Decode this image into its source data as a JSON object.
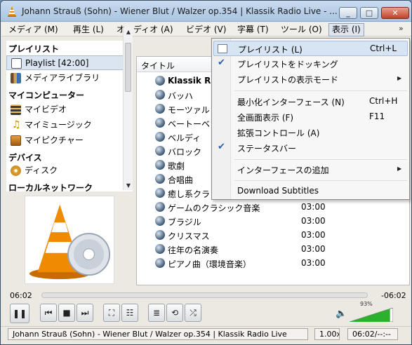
{
  "window": {
    "title": "Johann Strauß (Sohn) - Wiener Blut / Walzer op.354 | Klassik Radio Live - ..."
  },
  "menubar": {
    "items": [
      {
        "label": "メディア (M)"
      },
      {
        "label": "再生 (L)"
      },
      {
        "label": "オーディオ (A)"
      },
      {
        "label": "ビデオ (V)"
      },
      {
        "label": "字幕 (T)"
      },
      {
        "label": "ツール (O)"
      },
      {
        "label": "表示 (I)"
      }
    ],
    "overflow": "»"
  },
  "sidebar": {
    "sections": {
      "playlist": "プレイリスト",
      "my_computer": "マイコンピューター",
      "devices": "デバイス",
      "local_network": "ローカルネットワーク"
    },
    "items": {
      "playlist": "Playlist [42:00]",
      "media_library": "メディアライブラリ",
      "my_videos": "マイビデオ",
      "my_music": "マイミュージック",
      "my_pictures": "マイピクチャー",
      "discs": "ディスク"
    }
  },
  "playlist": {
    "column_title": "タイトル",
    "rows": [
      {
        "title": "Klassik R",
        "duration": "",
        "bold": true
      },
      {
        "title": "バッハ",
        "duration": ""
      },
      {
        "title": "モーツァル",
        "duration": ""
      },
      {
        "title": "ベートーベ",
        "duration": ""
      },
      {
        "title": "ベルディ",
        "duration": ""
      },
      {
        "title": "バロック",
        "duration": ""
      },
      {
        "title": "歌劇",
        "duration": ""
      },
      {
        "title": "合唱曲",
        "duration": ""
      },
      {
        "title": "癒し系クラ",
        "duration": ""
      },
      {
        "title": "ゲームのクラシック音楽",
        "duration": "03:00"
      },
      {
        "title": "ブラジル",
        "duration": "03:00"
      },
      {
        "title": "クリスマス",
        "duration": "03:00"
      },
      {
        "title": "往年の名演奏",
        "duration": "03:00"
      },
      {
        "title": "ピアノ曲（環境音楽）",
        "duration": "03:00"
      }
    ]
  },
  "view_menu": {
    "items": [
      {
        "label": "プレイリスト (L)",
        "shortcut": "Ctrl+L",
        "icon": "playlist-icon",
        "highlighted": true
      },
      {
        "label": "プレイリストをドッキング",
        "checked": true
      },
      {
        "label": "プレイリストの表示モード",
        "submenu": true
      },
      {
        "label": "最小化インターフェース (N)",
        "shortcut": "Ctrl+H"
      },
      {
        "label": "全画面表示 (F)",
        "shortcut": "F11"
      },
      {
        "label": "拡張コントロール (A)"
      },
      {
        "label": "ステータスバー",
        "checked": true
      },
      {
        "label": "インターフェースの追加",
        "submenu": true
      },
      {
        "label": "Download Subtitles"
      }
    ]
  },
  "seek": {
    "elapsed": "06:02",
    "remaining": "-06:02"
  },
  "volume": {
    "percent_label": "93%",
    "level": 0.93
  },
  "statusbar": {
    "now_playing": "Johann Strauß (Sohn) - Wiener Blut / Walzer op.354 | Klassik Radio Live",
    "speed": "1.00x",
    "time": "06:02/--:--"
  },
  "colors": {
    "accent": "#2a5ea8",
    "vlc_orange": "#f08a00",
    "volume_green": "#2db02d"
  }
}
